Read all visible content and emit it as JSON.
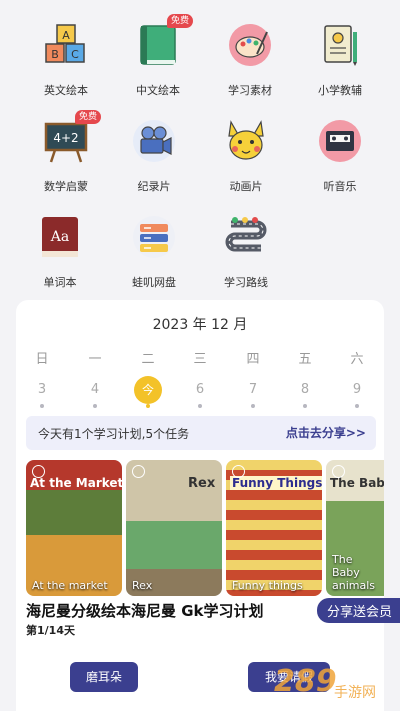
{
  "menu": {
    "items": [
      {
        "label": "英文绘本",
        "icon": "abc-blocks-icon",
        "badge": ""
      },
      {
        "label": "中文绘本",
        "icon": "green-book-icon",
        "badge": "免费"
      },
      {
        "label": "学习素材",
        "icon": "palette-icon",
        "badge": ""
      },
      {
        "label": "小学教辅",
        "icon": "worksheet-icon",
        "badge": ""
      },
      {
        "label": "数学启蒙",
        "icon": "chalkboard-icon",
        "badge": "免费"
      },
      {
        "label": "纪录片",
        "icon": "film-camera-icon",
        "badge": ""
      },
      {
        "label": "动画片",
        "icon": "cartoon-mouse-icon",
        "badge": ""
      },
      {
        "label": "听音乐",
        "icon": "cassette-icon",
        "badge": ""
      },
      {
        "label": "单词本",
        "icon": "dictionary-icon",
        "badge": ""
      },
      {
        "label": "蛙叽网盘",
        "icon": "cloud-drive-icon",
        "badge": ""
      },
      {
        "label": "学习路线",
        "icon": "road-route-icon",
        "badge": ""
      }
    ],
    "chalkboard_text": "4+2",
    "dictionary_text": "Aa"
  },
  "calendar": {
    "month": "2023 年 12 月",
    "weekdays": [
      "日",
      "一",
      "二",
      "三",
      "四",
      "五",
      "六"
    ],
    "days": [
      "3",
      "4",
      "今",
      "6",
      "7",
      "8",
      "9"
    ],
    "today_index": 2,
    "today_color": "#f3c229"
  },
  "plan": {
    "text": "今天有1个学习计划,5个任务",
    "share": "点击去分享>>"
  },
  "books": [
    {
      "caption": "At the market",
      "title": "At the Market"
    },
    {
      "caption": "Rex",
      "title": "Rex"
    },
    {
      "caption": "Funny things",
      "title": "Funny Things"
    },
    {
      "caption": "The Baby animals",
      "title": "The Baby"
    }
  ],
  "course": {
    "title": "海尼曼分级绘本海尼曼 Gk学习计划",
    "progress": "第1/14天",
    "vip_label": "分享送会员"
  },
  "buttons": {
    "left": "磨耳朵",
    "right": "我要请假"
  },
  "watermark": {
    "number": "289",
    "text": "手游网"
  },
  "colors": {
    "accent": "#3b3f8f",
    "badge": "#e5484d",
    "plan_bg": "#eeeffa"
  }
}
